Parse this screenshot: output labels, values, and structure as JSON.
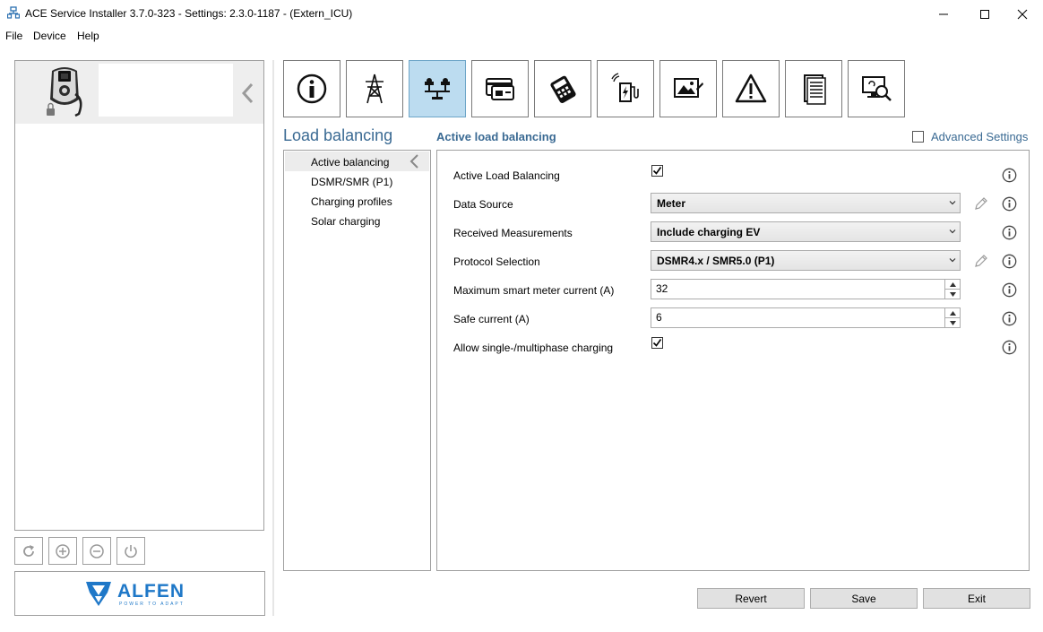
{
  "window": {
    "title": "ACE Service Installer 3.7.0-323 - Settings: 2.3.0-1187 -  (Extern_ICU)"
  },
  "menu": [
    "File",
    "Device",
    "Help"
  ],
  "toolbar": {
    "icons": [
      "info-icon",
      "power-grid-icon",
      "load-balancing-icon",
      "card-icon",
      "payment-terminal-icon",
      "charger-connectivity-icon",
      "display-image-icon",
      "warning-icon",
      "document-icon",
      "monitor-diagnostics-icon"
    ],
    "active_index": 2
  },
  "page": {
    "title": "Load balancing",
    "section_title": "Active load balancing",
    "advanced_settings_label": "Advanced Settings",
    "advanced_settings_checked": false
  },
  "nav": {
    "items": [
      "Active balancing",
      "DSMR/SMR (P1)",
      "Charging profiles",
      "Solar charging"
    ],
    "active": "Active balancing"
  },
  "fields": {
    "active_load_balancing": {
      "label": "Active Load Balancing",
      "checked": true
    },
    "data_source": {
      "label": "Data Source",
      "value": "Meter"
    },
    "received_measurements": {
      "label": "Received Measurements",
      "value": "Include charging EV"
    },
    "protocol_selection": {
      "label": "Protocol Selection",
      "value": "DSMR4.x / SMR5.0 (P1)"
    },
    "max_smart_meter_current": {
      "label": "Maximum smart meter current (A)",
      "value": "32"
    },
    "safe_current": {
      "label": "Safe current (A)",
      "value": "6"
    },
    "allow_phase_charging": {
      "label": "Allow single-/multiphase charging",
      "checked": true
    }
  },
  "buttons": {
    "revert": "Revert",
    "save": "Save",
    "exit": "Exit"
  },
  "logo": {
    "name": "ALFEN",
    "tagline": "POWER TO ADAPT"
  },
  "colors": {
    "accent_text": "#3a6a93",
    "active_tab_bg": "#bcdcf0",
    "logo_blue": "#1f78c8"
  }
}
